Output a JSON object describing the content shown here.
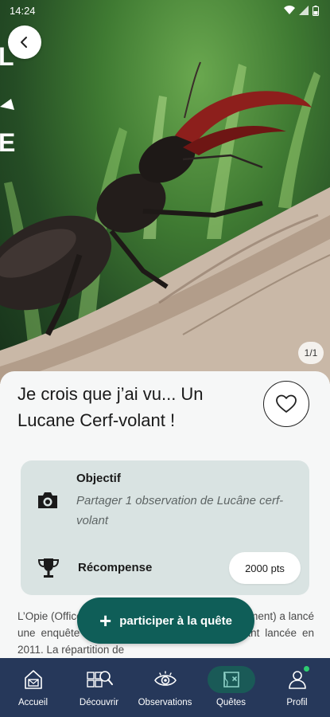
{
  "status_bar": {
    "time": "14:24"
  },
  "hero": {
    "image_counter": "1/1",
    "logo_letters": [
      "L",
      "E"
    ]
  },
  "quest": {
    "title": "Je crois que j’ai vu... Un Lucane Cerf-volant !",
    "objective_label": "Objectif",
    "objective_text": "Partager 1 observation de Lucâne cerf-volant",
    "reward_label": "Récompense",
    "reward_value": "2000 pts",
    "description": "L’Opie (Office pour les insectes et leur environnement) a lancé une enquête nationale sur le Lucane cerf-volant lancée en 2011. La répartition de"
  },
  "cta": {
    "label": "participer à la quête"
  },
  "nav": {
    "items": [
      {
        "label": "Accueil",
        "icon": "home-icon"
      },
      {
        "label": "Découvrir",
        "icon": "discover-icon"
      },
      {
        "label": "Observations",
        "icon": "eye-icon"
      },
      {
        "label": "Quêtes",
        "icon": "map-icon"
      },
      {
        "label": "Profil",
        "icon": "user-icon"
      }
    ],
    "active": "Quêtes"
  },
  "colors": {
    "accent": "#0f5e58",
    "nav_bg": "#26385a",
    "card_bg": "#d9e3e2",
    "badge": "#2ecc71"
  }
}
